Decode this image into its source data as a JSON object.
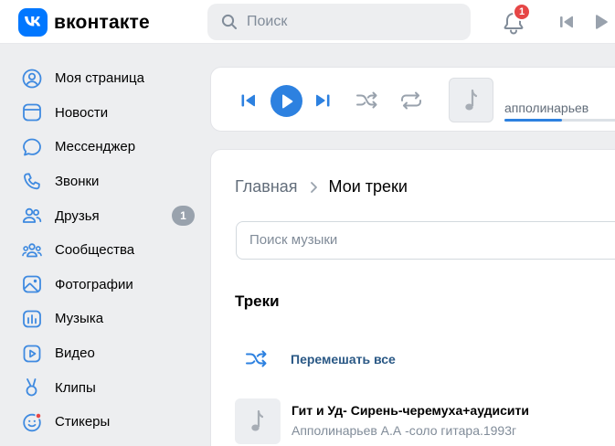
{
  "header": {
    "logo_text": "вконтакте",
    "search_placeholder": "Поиск",
    "notifications_count": "1"
  },
  "sidebar": {
    "items": [
      {
        "label": "Моя страница",
        "icon": "user-circle-icon"
      },
      {
        "label": "Новости",
        "icon": "news-icon"
      },
      {
        "label": "Мессенджер",
        "icon": "message-icon"
      },
      {
        "label": "Звонки",
        "icon": "phone-icon"
      },
      {
        "label": "Друзья",
        "icon": "friends-icon",
        "badge": "1"
      },
      {
        "label": "Сообщества",
        "icon": "communities-icon"
      },
      {
        "label": "Фотографии",
        "icon": "photos-icon"
      },
      {
        "label": "Музыка",
        "icon": "music-icon"
      },
      {
        "label": "Видео",
        "icon": "video-icon"
      },
      {
        "label": "Клипы",
        "icon": "clips-icon"
      },
      {
        "label": "Стикеры",
        "icon": "stickers-icon"
      }
    ]
  },
  "player": {
    "artist": "апполинарьев",
    "progress": 0.45
  },
  "main": {
    "breadcrumb_home": "Главная",
    "breadcrumb_current": "Мои треки",
    "search_placeholder": "Поиск музыки",
    "tracks_title": "Треки",
    "shuffle_label": "Перемешать все",
    "tracks": [
      {
        "title": "Гит и Уд- Сирень-черемуха+аудисити",
        "artist": "Апполинарьев А.А -соло гитара.1993г"
      }
    ]
  },
  "colors": {
    "accent": "#2d81e0",
    "brand": "#0077ff",
    "badge_red": "#e64646",
    "link": "#2a5885",
    "icon_blue": "#3f8ae0"
  }
}
